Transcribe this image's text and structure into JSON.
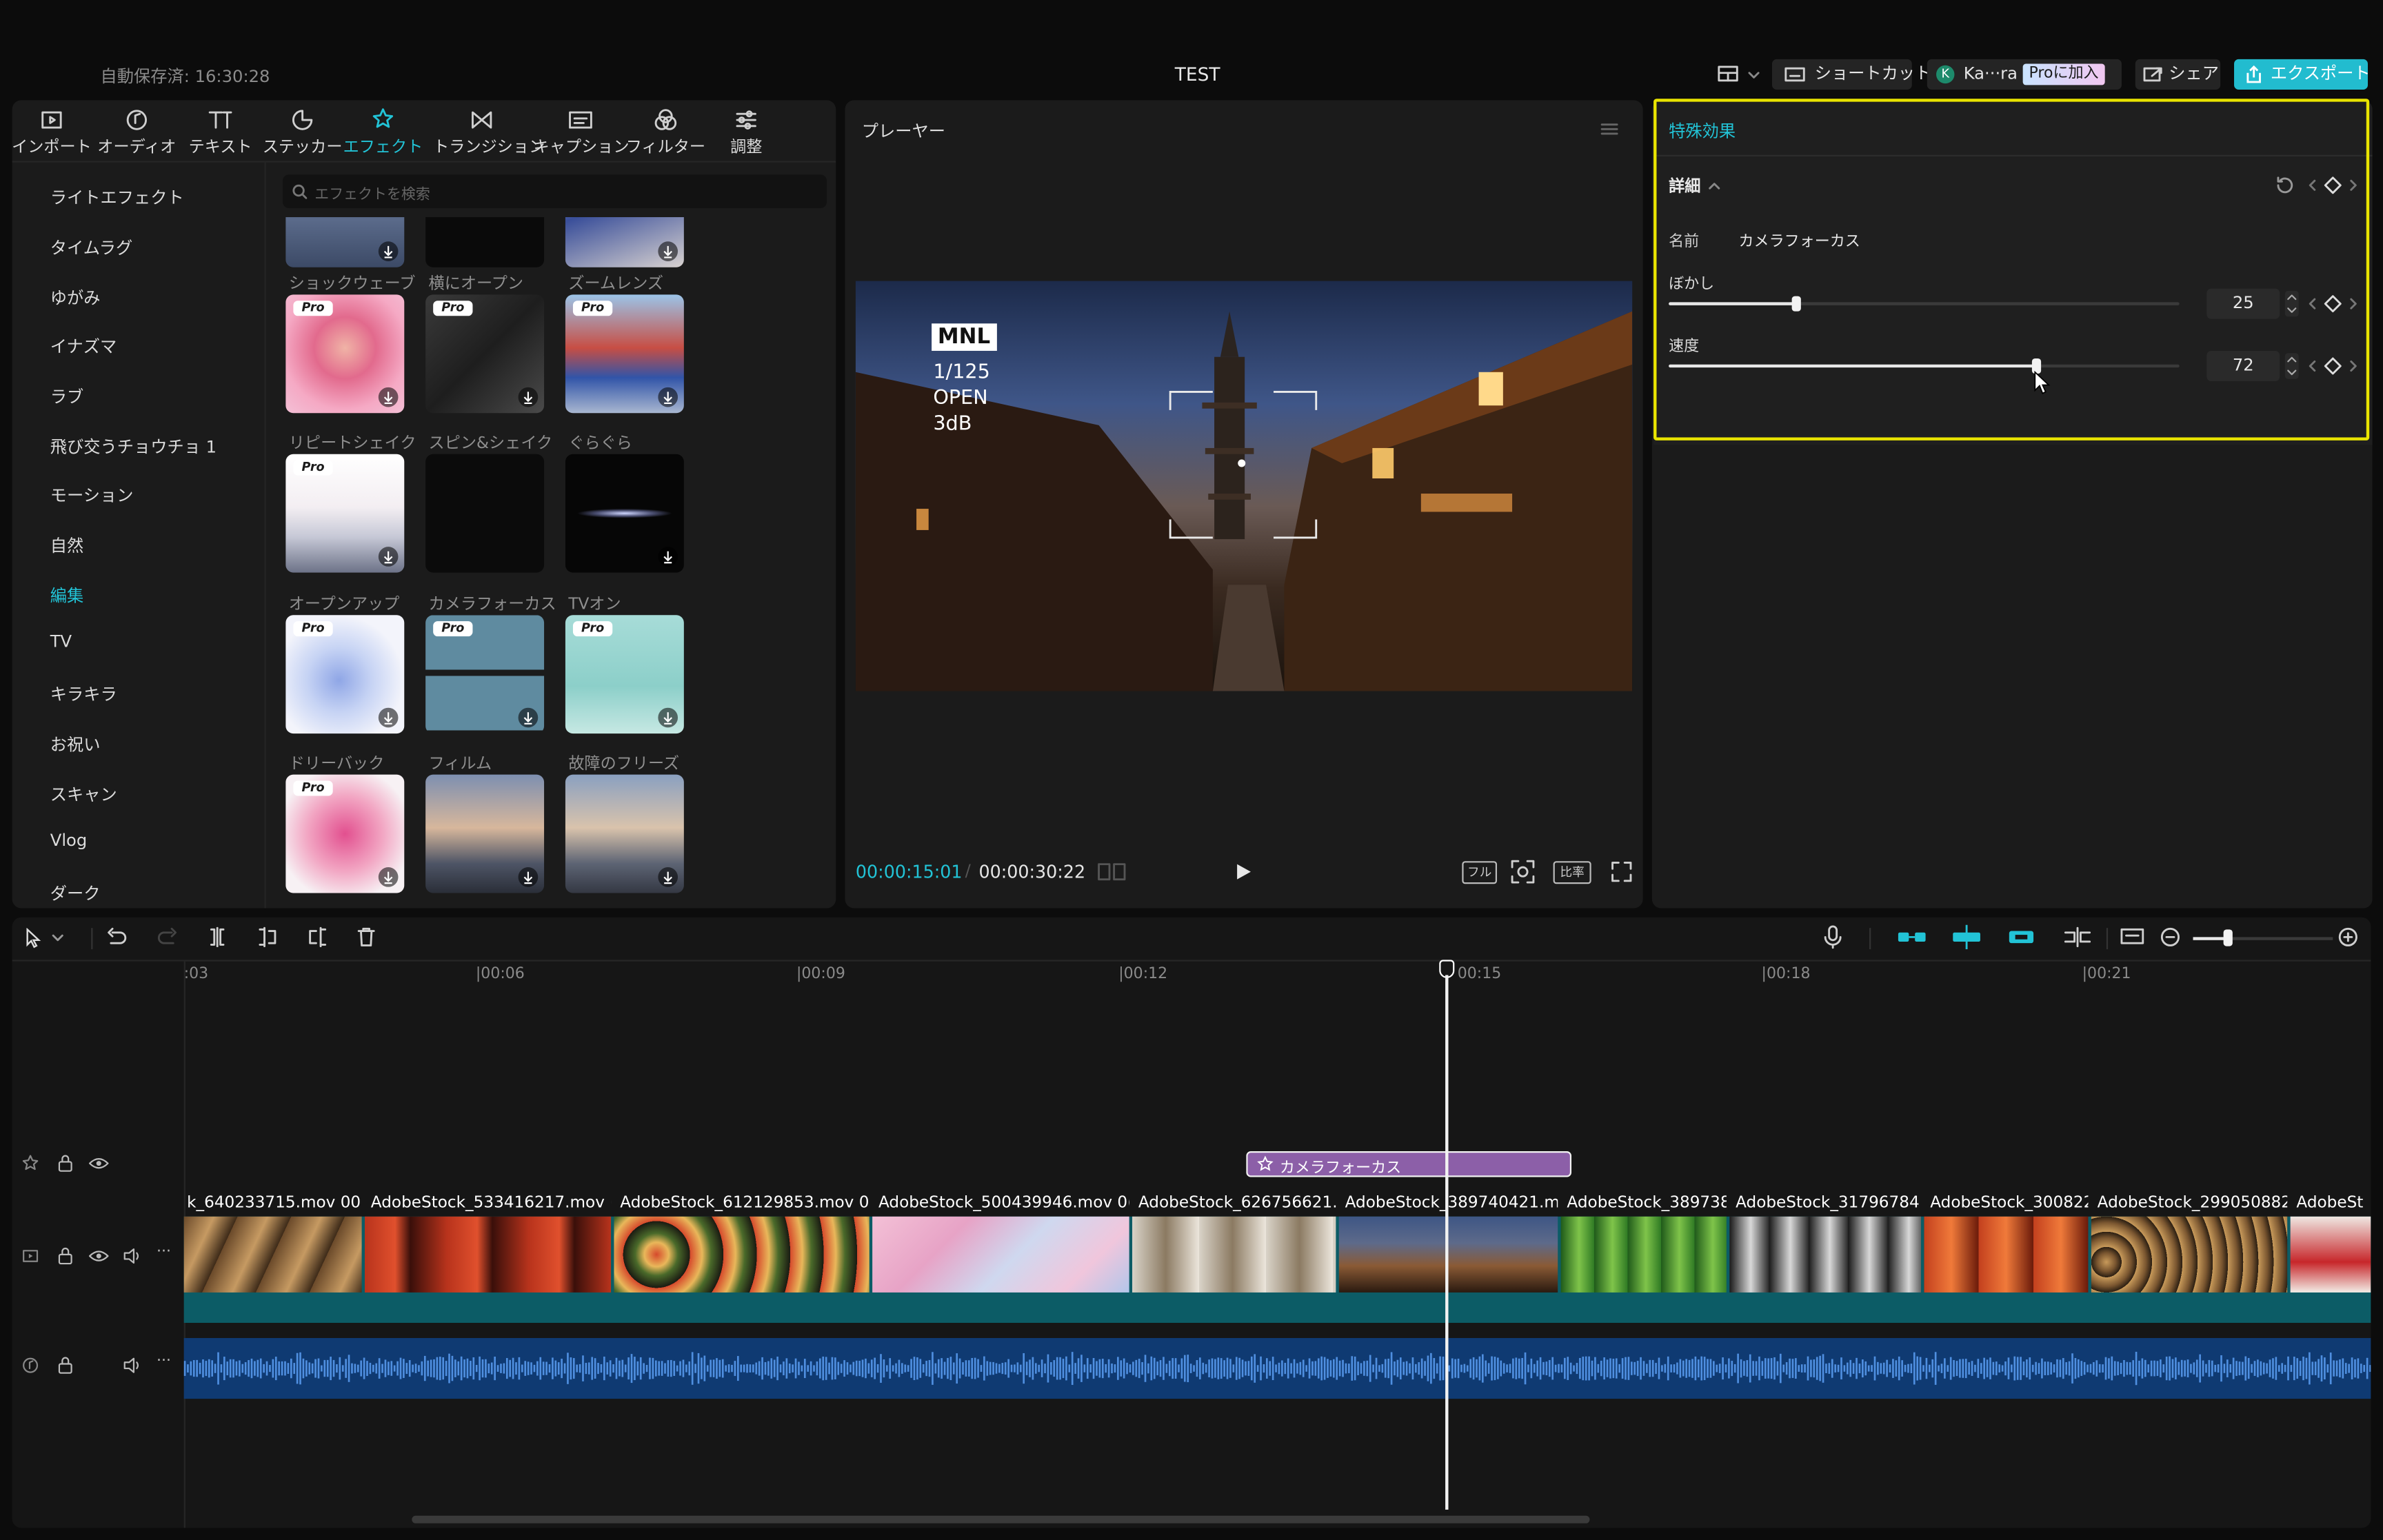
{
  "topbar": {
    "autosave": "自動保存済: 16:30:28",
    "title": "TEST",
    "shortcut": "ショートカット",
    "user_initial": "K",
    "user_name": "Ka···ra",
    "pro": "Proに加入",
    "share": "シェア",
    "export": "エクスポート"
  },
  "toolbar": {
    "tools": [
      {
        "label": "インポート",
        "icon": "import-icon"
      },
      {
        "label": "オーディオ",
        "icon": "audio-icon"
      },
      {
        "label": "テキスト",
        "icon": "text-icon"
      },
      {
        "label": "ステッカー",
        "icon": "sticker-icon"
      },
      {
        "label": "エフェクト",
        "icon": "effect-icon"
      },
      {
        "label": "トランジション",
        "icon": "transition-icon"
      },
      {
        "label": "キャプション",
        "icon": "caption-icon"
      },
      {
        "label": "フィルター",
        "icon": "filter-icon"
      },
      {
        "label": "調整",
        "icon": "adjust-icon"
      }
    ],
    "active": "エフェクト"
  },
  "categories": [
    "ライトエフェクト",
    "タイムラグ",
    "ゆがみ",
    "イナズマ",
    "ラブ",
    "飛び交うチョウチョ 1",
    "モーション",
    "自然",
    "編集",
    "TV",
    "キラキラ",
    "お祝い",
    "スキャン",
    "Vlog",
    "ダーク"
  ],
  "active_category": "編集",
  "search": {
    "placeholder": "エフェクトを検索"
  },
  "effects": {
    "row0": [
      "ショックウェーブ",
      "横にオープン",
      "ズームレンズ"
    ],
    "row1": [
      "リピートシェイク",
      "スピン&シェイク",
      "ぐらぐら"
    ],
    "row2": [
      "オープンアップ",
      "カメラフォーカス",
      "TVオン"
    ],
    "row3": [
      "ドリーバック",
      "フィルム",
      "故障のフリーズ"
    ],
    "pro_badge": "Pro"
  },
  "player": {
    "title": "プレーヤー",
    "overlay": {
      "l1": "MNL",
      "l2": "1/125",
      "l3": "OPEN",
      "l4": "3dB"
    },
    "current_time": "00:00:15:01",
    "separator": "/",
    "total_time": "00:00:30:22",
    "btn_full": "フル",
    "btn_ratio": "比率"
  },
  "details": {
    "header": "特殊効果",
    "section": "詳細",
    "name_label": "名前",
    "name_value": "カメラフォーカス",
    "blur_label": "ぼかし",
    "blur_value": "25",
    "blur_fraction": 0.25,
    "speed_label": "速度",
    "speed_value": "72",
    "speed_fraction": 0.72,
    "highlight_color": "#e9e400"
  },
  "timeline": {
    "ruler": [
      ":03",
      "|00:06",
      "|00:09",
      "|00:12",
      "00:15",
      "|00:18",
      "|00:21"
    ],
    "effect_clip": "カメラフォーカス",
    "clips": [
      "k_640233715.mov  00",
      "AdobeStock_533416217.mov  (",
      "AdobeStock_612129853.mov  0",
      "AdobeStock_500439946.mov  0(",
      "AdobeStock_626756621.r",
      "AdobeStock_389740421.m",
      "AdobeStock_389738",
      "AdobeStock_31796784",
      "AdobeStock_300822",
      "AdobeStock_299050882",
      "AdobeSt"
    ],
    "playhead_fraction": 0.5,
    "accent": "#22c3d6"
  }
}
